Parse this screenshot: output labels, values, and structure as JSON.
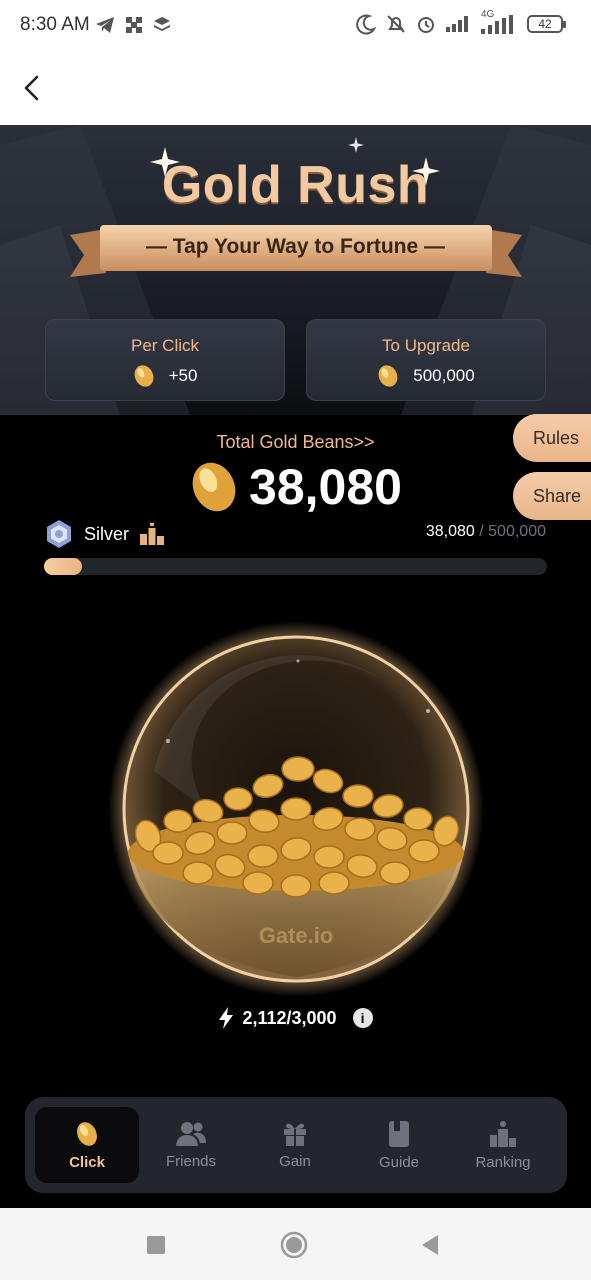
{
  "status_bar": {
    "time": "8:30 AM",
    "network": "4G",
    "battery": "42"
  },
  "header": {
    "back_label": "Back"
  },
  "hero": {
    "title": "Gold Rush",
    "subtitle": "— Tap Your Way to Fortune —"
  },
  "stats": {
    "per_click": {
      "label": "Per Click",
      "value": "+50"
    },
    "to_upgrade": {
      "label": "To Upgrade",
      "value": "500,000"
    }
  },
  "side_buttons": {
    "rules": "Rules",
    "share": "Share"
  },
  "total": {
    "label": "Total Gold Beans>>",
    "value": "38,080"
  },
  "level": {
    "name": "Silver",
    "current": "38,080",
    "separator": "/",
    "target": "500,000",
    "progress_fraction": 0.076
  },
  "orb": {
    "brand": "Gate.io"
  },
  "energy": {
    "value": "2,112/3,000"
  },
  "tabs": [
    {
      "label": "Click",
      "icon": "bean-icon",
      "active": true
    },
    {
      "label": "Friends",
      "icon": "friends-icon",
      "active": false
    },
    {
      "label": "Gain",
      "icon": "gift-icon",
      "active": false
    },
    {
      "label": "Guide",
      "icon": "book-icon",
      "active": false
    },
    {
      "label": "Ranking",
      "icon": "podium-icon",
      "active": false
    }
  ],
  "colors": {
    "accent": "#f0b98a",
    "gold": "#e8b048",
    "background": "#000000",
    "card": "#2c303a"
  }
}
